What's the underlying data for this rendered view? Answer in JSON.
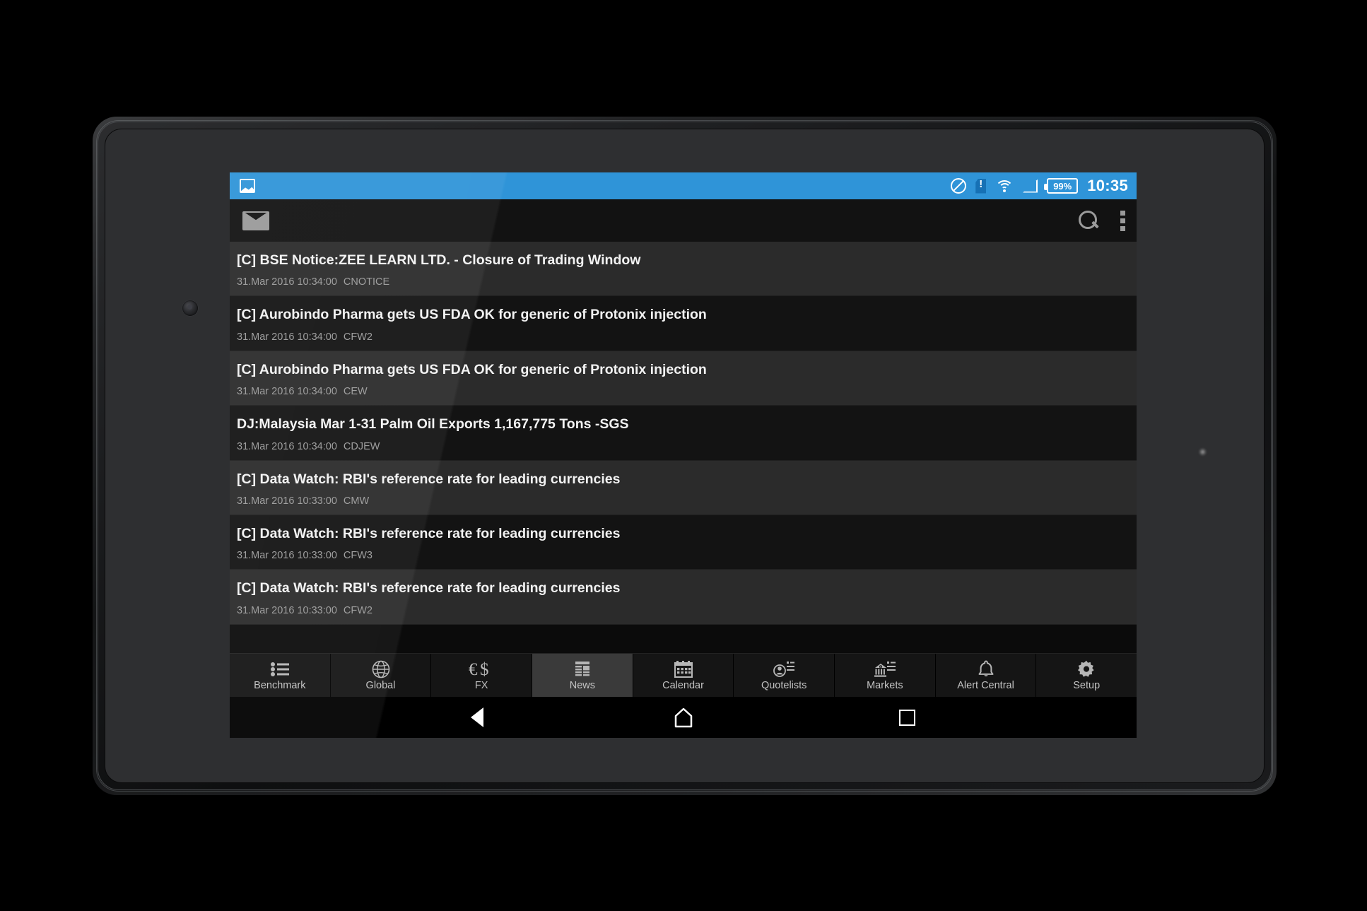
{
  "status_bar": {
    "notification_icon": "image-icon",
    "icons": [
      "do-not-disturb-icon",
      "sim-card-alert-icon",
      "wifi-icon",
      "cell-signal-icon"
    ],
    "battery_percent": "99%",
    "time": "10:35"
  },
  "app_bar": {
    "mail_icon": "mail-icon",
    "search_icon": "search-icon",
    "overflow_icon": "overflow-menu-icon"
  },
  "news": {
    "items": [
      {
        "title": "[C] BSE Notice:ZEE LEARN LTD. - Closure of Trading Window",
        "date": "31.Mar 2016 10:34:00",
        "source": "CNOTICE"
      },
      {
        "title": "[C] Aurobindo Pharma gets US FDA OK for generic of Protonix injection",
        "date": "31.Mar 2016 10:34:00",
        "source": "CFW2"
      },
      {
        "title": "[C] Aurobindo Pharma gets US FDA OK for generic of Protonix injection",
        "date": "31.Mar 2016 10:34:00",
        "source": "CEW"
      },
      {
        "title": "DJ:Malaysia Mar 1-31 Palm Oil Exports 1,167,775 Tons -SGS",
        "date": "31.Mar 2016 10:34:00",
        "source": "CDJEW"
      },
      {
        "title": "[C] Data Watch: RBI's reference rate for leading currencies",
        "date": "31.Mar 2016 10:33:00",
        "source": "CMW"
      },
      {
        "title": "[C] Data Watch: RBI's reference rate for leading currencies",
        "date": "31.Mar 2016 10:33:00",
        "source": "CFW3"
      },
      {
        "title": "[C] Data Watch: RBI's reference rate for leading currencies",
        "date": "31.Mar 2016 10:33:00",
        "source": "CFW2"
      }
    ]
  },
  "tabs": [
    {
      "label": "Benchmark",
      "icon": "bulleted-list-icon",
      "active": false
    },
    {
      "label": "Global",
      "icon": "globe-icon",
      "active": false
    },
    {
      "label": "FX",
      "icon": "euro-dollar-icon",
      "active": false
    },
    {
      "label": "News",
      "icon": "newspaper-icon",
      "active": true
    },
    {
      "label": "Calendar",
      "icon": "calendar-icon",
      "active": false
    },
    {
      "label": "Quotelists",
      "icon": "person-list-icon",
      "active": false
    },
    {
      "label": "Markets",
      "icon": "bank-icon",
      "active": false
    },
    {
      "label": "Alert Central",
      "icon": "bell-icon",
      "active": false
    },
    {
      "label": "Setup",
      "icon": "gear-icon",
      "active": false
    }
  ],
  "nav_bar": {
    "back": "back-triangle-icon",
    "home": "home-pentagon-icon",
    "recents": "recents-square-icon"
  },
  "colors": {
    "status_bar_blue": "#2f94d8",
    "screen_bg": "#0b0b0b",
    "row_odd": "#2b2b2b",
    "row_even": "#131313",
    "tab_active": "#3a3a3a"
  }
}
